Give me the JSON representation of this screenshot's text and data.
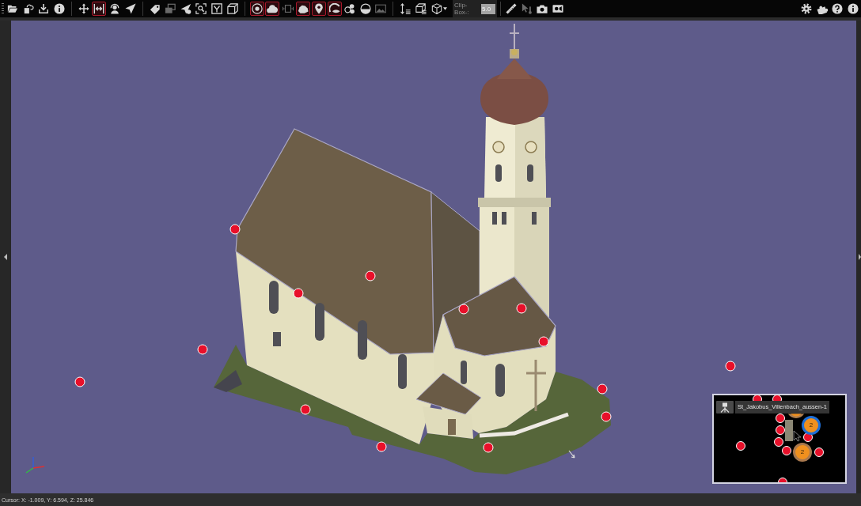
{
  "toolbar": {
    "groups": [
      [
        {
          "kind": "button",
          "on": false,
          "disabled": false
        },
        {
          "kind": "button",
          "on": false,
          "disabled": false
        },
        {
          "kind": "button",
          "on": false,
          "disabled": false
        },
        {
          "kind": "button",
          "on": false,
          "disabled": false
        }
      ],
      [
        {
          "kind": "button",
          "on": false,
          "disabled": false
        },
        {
          "kind": "button",
          "on": true,
          "disabled": false
        },
        {
          "kind": "button",
          "on": false,
          "disabled": false
        },
        {
          "kind": "button",
          "on": false,
          "disabled": false
        }
      ],
      [
        {
          "kind": "button",
          "on": false,
          "disabled": false
        },
        {
          "kind": "button",
          "on": false,
          "disabled": true
        },
        {
          "kind": "button",
          "on": false,
          "disabled": false
        },
        {
          "kind": "button",
          "on": false,
          "disabled": false
        },
        {
          "kind": "button",
          "on": false,
          "disabled": false
        },
        {
          "kind": "button",
          "on": false,
          "disabled": false
        }
      ],
      [
        {
          "kind": "button",
          "on": true,
          "disabled": false
        },
        {
          "kind": "button",
          "on": true,
          "disabled": false
        },
        {
          "kind": "button",
          "on": false,
          "disabled": true
        },
        {
          "kind": "button",
          "on": true,
          "disabled": false
        },
        {
          "kind": "button",
          "on": true,
          "disabled": false
        },
        {
          "kind": "button",
          "on": true,
          "disabled": false
        },
        {
          "kind": "button",
          "on": false,
          "disabled": false
        },
        {
          "kind": "button",
          "on": false,
          "disabled": false
        },
        {
          "kind": "button",
          "on": false,
          "disabled": true
        }
      ],
      [
        {
          "kind": "button",
          "on": false,
          "disabled": false
        },
        {
          "kind": "button",
          "on": false,
          "disabled": false
        },
        {
          "kind": "dropdown",
          "on": false,
          "disabled": false
        }
      ],
      [
        {
          "kind": "button",
          "on": false,
          "disabled": false
        },
        {
          "kind": "button",
          "on": false,
          "disabled": true
        },
        {
          "kind": "button",
          "on": false,
          "disabled": false
        },
        {
          "kind": "button",
          "on": false,
          "disabled": false
        }
      ]
    ],
    "clip_box": {
      "label": "Clip-Box-:",
      "value": "5.0"
    },
    "right": [
      {
        "kind": "button",
        "on": false,
        "disabled": false
      },
      {
        "kind": "button",
        "on": false,
        "disabled": false
      },
      {
        "kind": "button",
        "on": false,
        "disabled": false
      },
      {
        "kind": "button",
        "on": false,
        "disabled": false
      }
    ]
  },
  "viewport": {
    "scan_label": "St_Jakobus_Villenbach_aussen-1",
    "clusters": [
      {
        "count": "2",
        "selected": true
      },
      {
        "count": "2",
        "selected": false
      }
    ]
  },
  "status_bar": {
    "cursor": "Cursor: X: -1.009, Y: 6.594, Z: 25.846"
  }
}
